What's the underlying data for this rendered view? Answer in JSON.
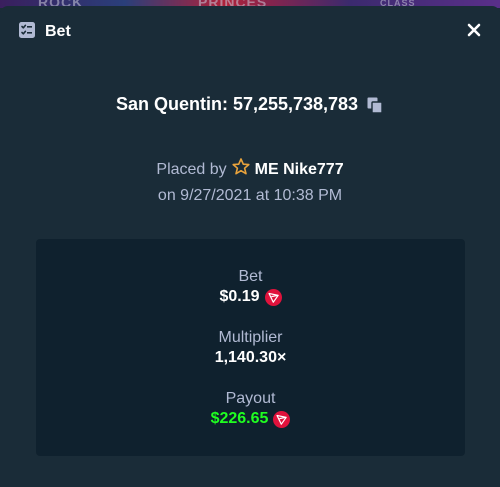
{
  "background": {
    "fragments": [
      "ROCK",
      "PRINCES",
      "CLASS"
    ]
  },
  "modal": {
    "title": "Bet",
    "title_icon": "bet-slip-icon",
    "close_icon": "close-icon"
  },
  "bet": {
    "game": "San Quentin",
    "bet_id": "57,255,738,783",
    "game_line": "San Quentin: 57,255,738,783",
    "placed_by_label": "Placed by",
    "user_icon": "star-icon",
    "username": "ME Nike777",
    "date_line": "on 9/27/2021 at 10:38 PM"
  },
  "stats": {
    "bet_label": "Bet",
    "bet_value": "$0.19",
    "multiplier_label": "Multiplier",
    "multiplier_value": "1,140.30×",
    "payout_label": "Payout",
    "payout_value": "$226.65",
    "currency_icon": "tron-coin-icon"
  },
  "colors": {
    "background": "#1a2c38",
    "card": "#0f212e",
    "text_primary": "#ffffff",
    "text_secondary": "#b1bad3",
    "payout_green": "#1fff20",
    "coin_red": "#e0123c"
  }
}
